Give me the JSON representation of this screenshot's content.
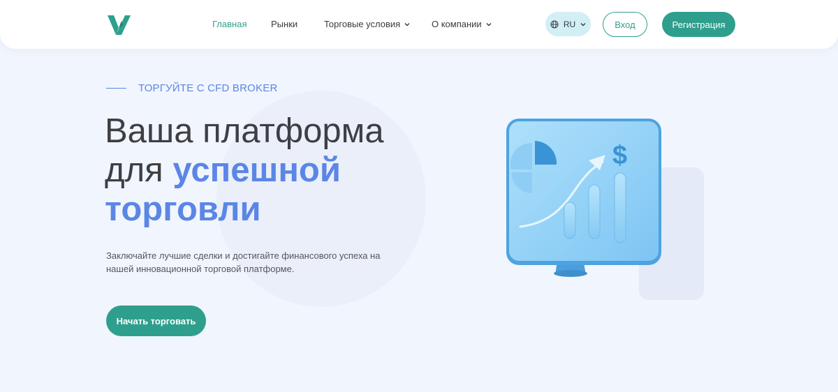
{
  "nav": {
    "items": [
      {
        "label": "Главная",
        "active": true,
        "dropdown": false
      },
      {
        "label": "Рынки",
        "active": false,
        "dropdown": false
      },
      {
        "label": "Торговые условия",
        "active": false,
        "dropdown": true
      },
      {
        "label": "О компании",
        "active": false,
        "dropdown": true
      }
    ]
  },
  "header": {
    "language": "RU",
    "login_label": "Вход",
    "register_label": "Регистрация"
  },
  "hero": {
    "eyebrow": "ТОРГУЙТЕ С CFD BROKER",
    "title_line1": "Ваша платформа",
    "title_line2_plain": "для ",
    "title_line2_highlight": "успешной",
    "title_line3_highlight": "торговли",
    "description": "Заключайте лучшие сделки и достигайте финансового успеха на нашей инновационной торговой платформе.",
    "cta_label": "Начать торговать"
  },
  "colors": {
    "brand_teal": "#2f9f8d",
    "accent_blue": "#5b86e5",
    "page_background": "#f1f5fd"
  },
  "icons": [
    "logo-icon",
    "globe-icon",
    "chevron-down-icon",
    "monitor-chart-illustration"
  ]
}
